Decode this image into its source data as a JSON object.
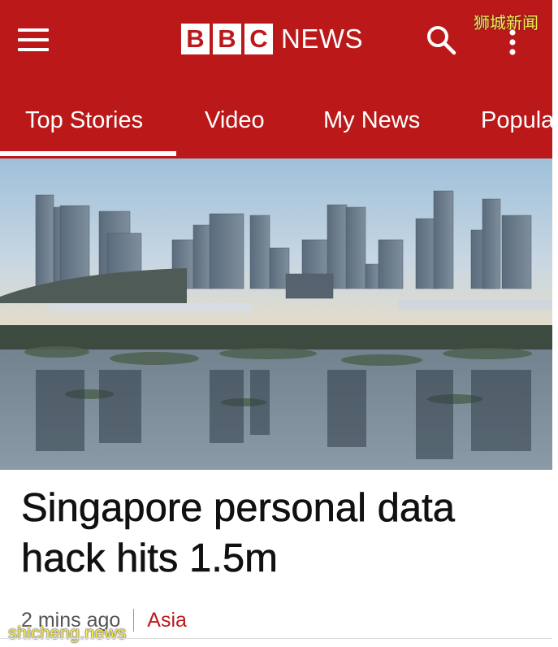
{
  "header": {
    "brand_letters": [
      "B",
      "B",
      "C"
    ],
    "brand_word": "NEWS",
    "icons": {
      "menu": "hamburger-menu-icon",
      "search": "search-icon",
      "more": "more-vertical-icon"
    }
  },
  "tabs": [
    {
      "label": "Top Stories",
      "active": true
    },
    {
      "label": "Video",
      "active": false
    },
    {
      "label": "My News",
      "active": false
    },
    {
      "label": "Popula",
      "active": false
    }
  ],
  "article": {
    "headline": "Singapore personal data hack hits 1.5m",
    "timestamp": "2 mins ago",
    "section": "Asia"
  },
  "watermarks": {
    "top": "狮城新闻",
    "bottom": "shicheng.news"
  },
  "colors": {
    "brand_red": "#bb1919",
    "header_text": "#ffffff",
    "headline_text": "#111111",
    "meta_text": "#555555",
    "section_link": "#bb1919"
  }
}
